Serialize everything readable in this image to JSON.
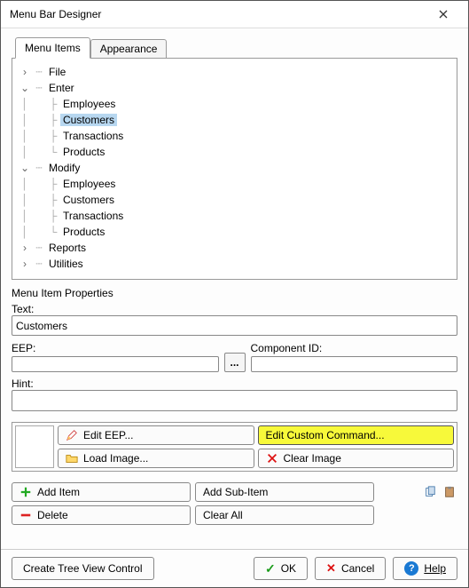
{
  "window": {
    "title": "Menu Bar Designer"
  },
  "tabs": {
    "menu_items": "Menu Items",
    "appearance": "Appearance"
  },
  "tree": {
    "file": "File",
    "enter": "Enter",
    "enter_children": {
      "employees": "Employees",
      "customers": "Customers",
      "transactions": "Transactions",
      "products": "Products"
    },
    "modify": "Modify",
    "modify_children": {
      "employees": "Employees",
      "customers": "Customers",
      "transactions": "Transactions",
      "products": "Products"
    },
    "reports": "Reports",
    "utilities": "Utilities"
  },
  "properties": {
    "group_label": "Menu Item Properties",
    "text_label": "Text:",
    "text_value": "Customers",
    "eep_label": "EEP:",
    "eep_value": "",
    "component_label": "Component ID:",
    "component_value": "",
    "hint_label": "Hint:",
    "hint_value": "",
    "ellipsis": "..."
  },
  "cmd": {
    "edit_eep": "Edit EEP...",
    "edit_custom": "Edit Custom Command...",
    "load_image": "Load Image...",
    "clear_image": "Clear Image"
  },
  "actions": {
    "add_item": "Add Item",
    "add_sub_item": "Add Sub-Item",
    "delete": "Delete",
    "clear_all": "Clear All"
  },
  "bottom": {
    "create_tree": "Create Tree View Control",
    "ok": "OK",
    "cancel": "Cancel",
    "help": "Help"
  },
  "glyph": {
    "collapsed": "›",
    "expanded": "⌄"
  }
}
